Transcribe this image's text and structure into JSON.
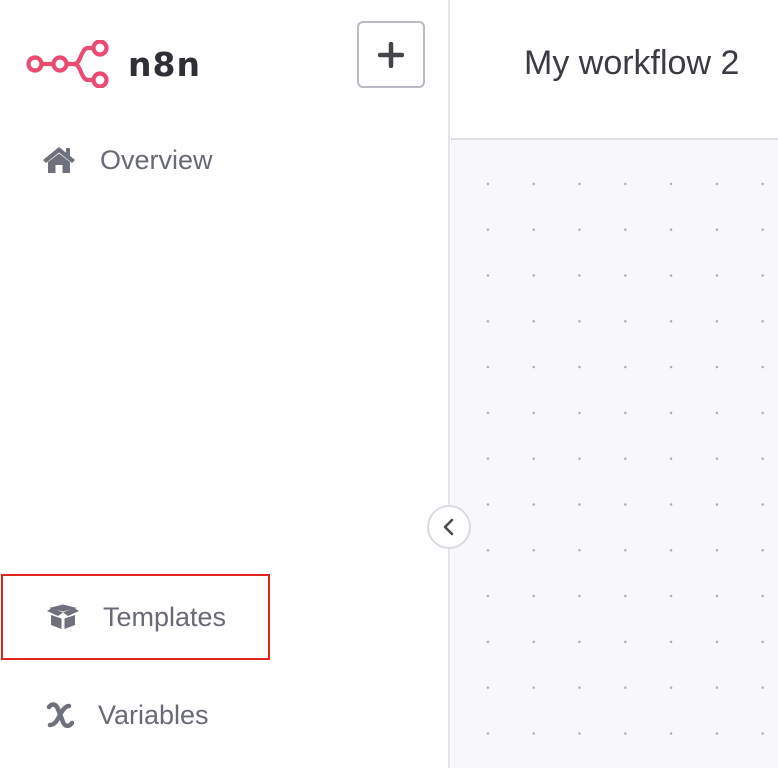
{
  "app": {
    "logo_text": "n8n",
    "brand_color": "#ea4b71"
  },
  "sidebar": {
    "add_button_icon": "plus-icon",
    "items": [
      {
        "label": "Overview",
        "icon": "home-icon"
      },
      {
        "label": "Templates",
        "icon": "box-open-icon"
      },
      {
        "label": "Variables",
        "icon": "variable-x-icon"
      }
    ],
    "collapse_icon": "chevron-left-icon"
  },
  "header": {
    "workflow_title": "My workflow 2"
  },
  "highlight_color": "#e0251b"
}
